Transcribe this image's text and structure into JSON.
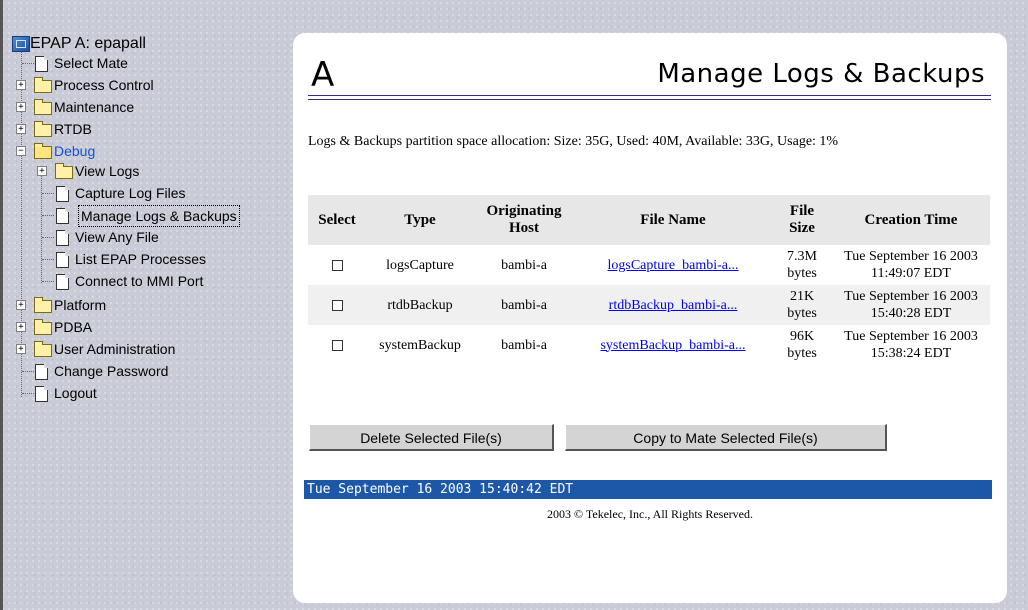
{
  "tree": {
    "root_label": "EPAP A: epapall",
    "items": [
      {
        "label": "Select Mate"
      },
      {
        "label": "Process Control"
      },
      {
        "label": "Maintenance"
      },
      {
        "label": "RTDB"
      },
      {
        "label": "Debug"
      },
      {
        "label": "View Logs"
      },
      {
        "label": "Capture Log Files"
      },
      {
        "label": "Manage Logs & Backups"
      },
      {
        "label": "View Any File"
      },
      {
        "label": "List EPAP Processes"
      },
      {
        "label": "Connect to MMI Port"
      },
      {
        "label": "Platform"
      },
      {
        "label": "PDBA"
      },
      {
        "label": "User Administration"
      },
      {
        "label": "Change Password"
      },
      {
        "label": "Logout"
      }
    ],
    "expand_glyph": "+",
    "collapse_glyph": "−"
  },
  "page": {
    "letter": "A",
    "title": "Manage Logs & Backups",
    "partition_text": "Logs & Backups partition space allocation: Size: 35G, Used: 40M, Available: 33G, Usage: 1%"
  },
  "table": {
    "headers": {
      "select": "Select",
      "type": "Type",
      "host": "Originating Host",
      "file_name": "File Name",
      "file_size": "File Size",
      "creation_time": "Creation Time"
    },
    "rows": [
      {
        "type": "logsCapture",
        "host": "bambi-a",
        "file_name": "logsCapture_bambi-a...",
        "file_size": "7.3M bytes",
        "creation_time": "Tue September 16 2003 11:49:07 EDT"
      },
      {
        "type": "rtdbBackup",
        "host": "bambi-a",
        "file_name": "rtdbBackup_bambi-a...",
        "file_size": "21K bytes",
        "creation_time": "Tue September 16 2003 15:40:28 EDT"
      },
      {
        "type": "systemBackup",
        "host": "bambi-a",
        "file_name": "systemBackup_bambi-a...",
        "file_size": "96K bytes",
        "creation_time": "Tue September 16 2003 15:38:24 EDT"
      }
    ]
  },
  "buttons": {
    "delete": "Delete Selected File(s)",
    "copy": "Copy to Mate Selected File(s)"
  },
  "footer": {
    "timestamp": "Tue September 16 2003 15:40:42 EDT",
    "copyright": "2003 © Tekelec, Inc., All Rights Reserved."
  },
  "colors": {
    "timebar": "#1d57a8",
    "link": "#0000ee",
    "debug_folder_text": "#1a4fd6"
  }
}
